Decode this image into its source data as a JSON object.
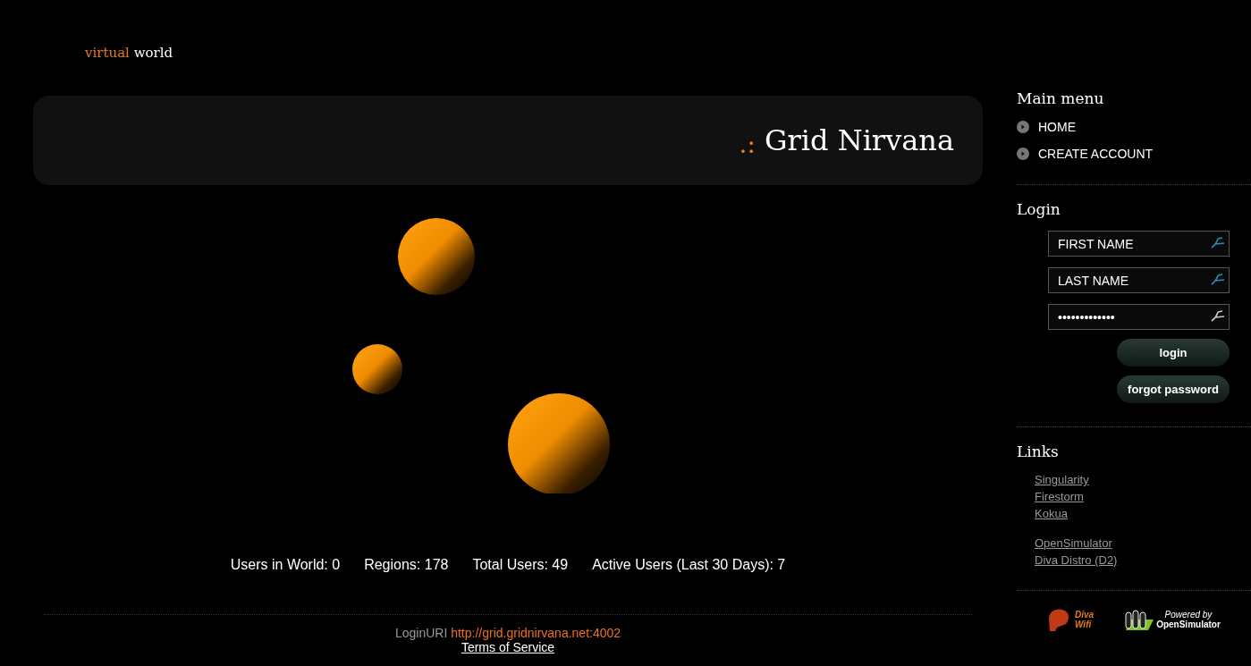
{
  "logo": {
    "first": "virtual",
    "second": "world"
  },
  "banner": {
    "prefix": ".:",
    "title": "Grid Nirvana"
  },
  "stats": [
    "Users in World: 0",
    "Regions: 178",
    "Total Users: 49",
    "Active Users (Last 30 Days): 7"
  ],
  "footer": {
    "label": "LoginURI",
    "uri": "http://grid.gridnirvana.net:4002",
    "terms": "Terms of Service"
  },
  "sidebar": {
    "main_menu": {
      "title": "Main menu",
      "items": [
        "HOME",
        "CREATE ACCOUNT"
      ]
    },
    "login": {
      "title": "Login",
      "fields": [
        {
          "kind": "text",
          "placeholder": "FIRST NAME"
        },
        {
          "kind": "text",
          "placeholder": "LAST NAME"
        },
        {
          "kind": "password",
          "value": "•••••••••••••"
        }
      ],
      "buttons": [
        "login",
        "forgot password"
      ]
    },
    "links": {
      "title": "Links",
      "groups": [
        [
          "Singularity",
          "Firestorm",
          "Kokua"
        ],
        [
          "OpenSimulator",
          "Diva Distro (D2)"
        ]
      ]
    },
    "badges": {
      "diva": [
        "Diva",
        "Wifi"
      ],
      "opensim": [
        "Powered by",
        "OpenSimulator"
      ]
    }
  }
}
